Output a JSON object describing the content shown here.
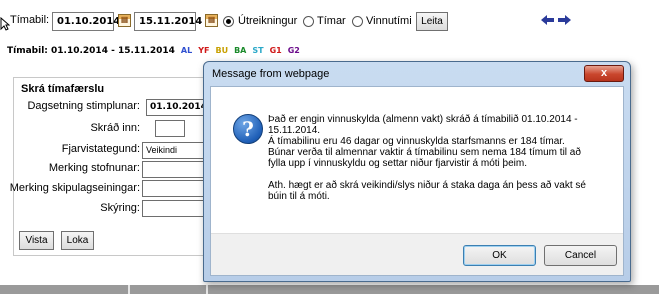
{
  "filter": {
    "period_label": "Tímabil:",
    "from_date": "01.10.2014",
    "to_date": "15.11.2014",
    "radio_options": [
      {
        "label": "Útreikningur",
        "selected": true
      },
      {
        "label": "Tímar",
        "selected": false
      },
      {
        "label": "Vinnutími",
        "selected": false
      }
    ],
    "search_label": "Leita"
  },
  "period_title": "Tímabil: 01.10.2014 - 15.11.2014",
  "legend": [
    {
      "code": "AL",
      "color": "#2f4fd0"
    },
    {
      "code": "YF",
      "color": "#d01818"
    },
    {
      "code": "BU",
      "color": "#c8a000"
    },
    {
      "code": "BA",
      "color": "#1a8a2a"
    },
    {
      "code": "ST",
      "color": "#2aa8c8"
    },
    {
      "code": "G1",
      "color": "#d01818"
    },
    {
      "code": "G2",
      "color": "#6a0a8a"
    }
  ],
  "form": {
    "title": "Skrá tímafærslu",
    "fields": [
      {
        "label": "Dagsetning stimplunar:",
        "value": "01.10.2014"
      },
      {
        "label": "Skráð inn:",
        "value": ""
      },
      {
        "label": "Fjarvistategund:",
        "value": "Veikindi"
      },
      {
        "label": "Merking stofnunar:",
        "value": ""
      },
      {
        "label": "Merking skipulagseiningar:",
        "value": ""
      },
      {
        "label": "Skýring:",
        "value": ""
      }
    ],
    "show_label": "Vista",
    "close_label": "Loka"
  },
  "dialog": {
    "title": "Message from webpage",
    "close_glyph": "x",
    "icon": "info-icon",
    "lines": [
      "Það er engin vinnuskylda (almenn vakt) skráð á tímabilið 01.10.2014 -",
      "15.11.2014.",
      "Á tímabilinu  eru 46 dagar og vinnuskylda starfsmanns er 184 tímar.",
      "Búnar verða til almennar vaktir á tímabilinu sem nema 184 tímum til að",
      "fylla upp í vinnuskyldu og settar niður fjarvistir á móti þeim.",
      "",
      "Ath. hægt er að skrá veikindi/slys niður á staka daga án þess að vakt sé",
      "búin til á móti."
    ],
    "ok_label": "OK",
    "cancel_label": "Cancel"
  },
  "icons": {
    "calendar": "calendar-icon",
    "prev_next": "prev-next-arrows-icon"
  }
}
